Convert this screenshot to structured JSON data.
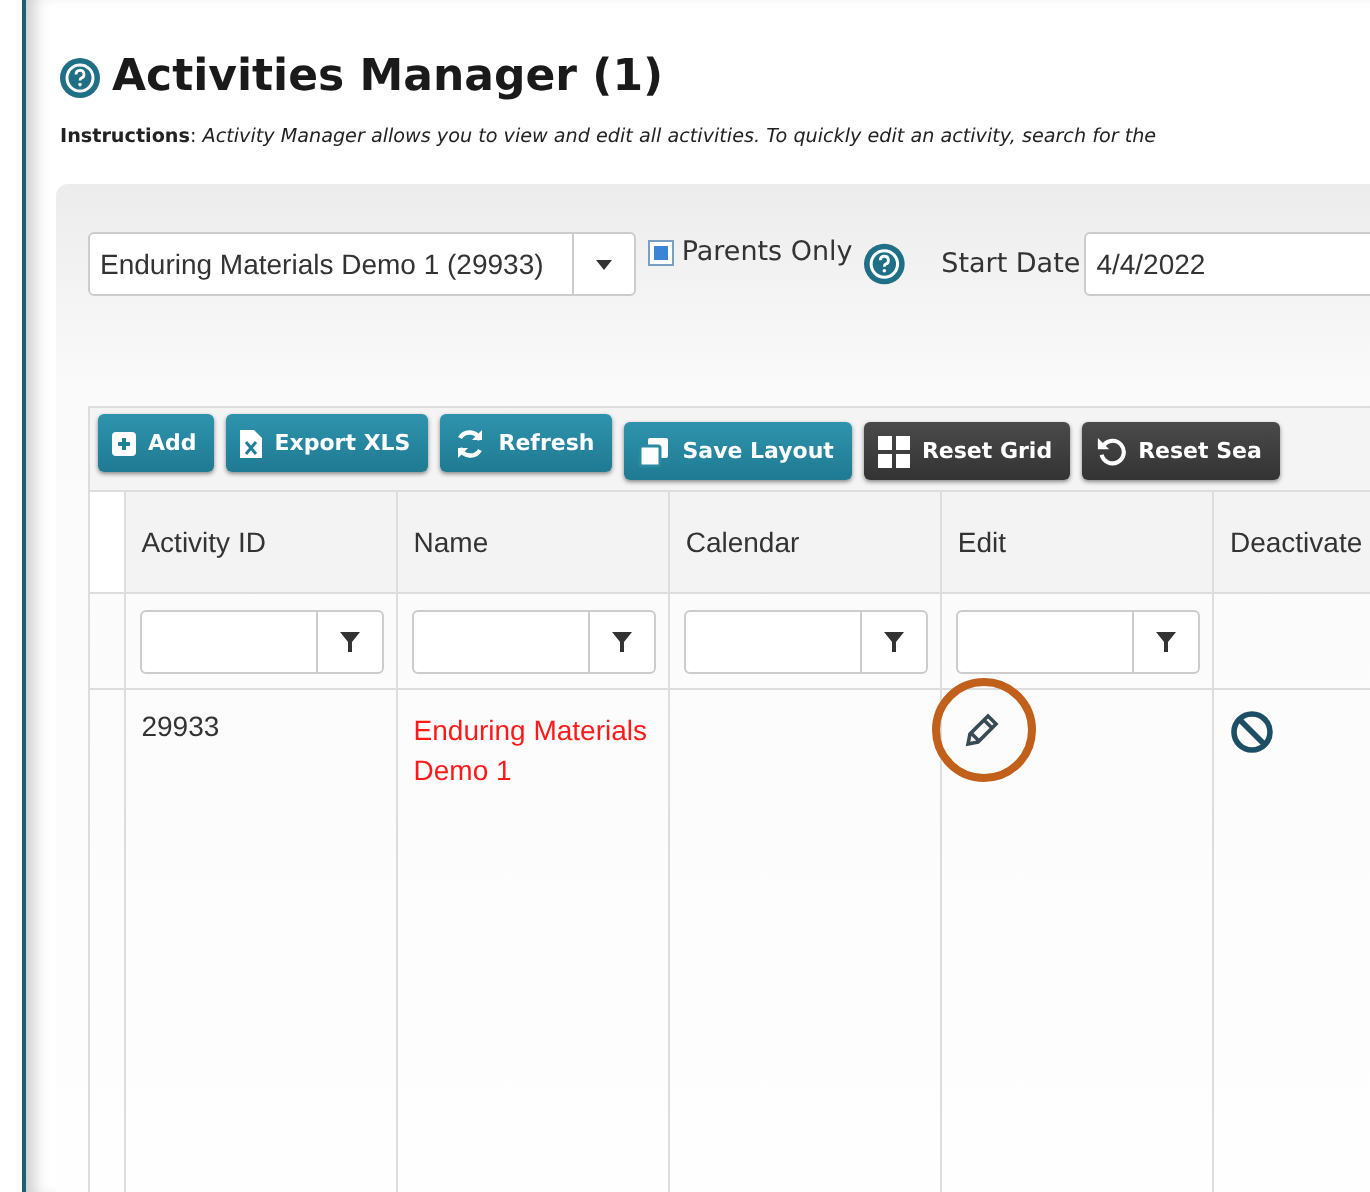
{
  "title": "Activities Manager (1)",
  "instructions": "**Instructions**: *Activity Manager allows you to view and edit all activities. To quickly edit an activity, search for the*",
  "filters": {
    "activity": "Enduring Materials Demo 1 (29933)",
    "parents_only": {
      "label": "Parents Only",
      "checked": true
    },
    "start_date": {
      "label": "Start Date",
      "value": "4/4/2022"
    }
  },
  "toolbar": [
    {
      "label": "Add",
      "kind": "add"
    },
    {
      "label": "Export XLS",
      "kind": "export"
    },
    {
      "label": "Refresh",
      "kind": "refresh"
    },
    {
      "label": "Save Layout",
      "kind": "save"
    },
    {
      "label": "Reset Grid",
      "kind": "grid"
    },
    {
      "label": "Reset Sea",
      "kind": "reset"
    }
  ],
  "table": {
    "columns": [
      {
        "label": "Activity ID",
        "filter": true
      },
      {
        "label": "Name",
        "filter": true
      },
      {
        "label": "Calendar",
        "filter": true
      },
      {
        "label": "Edit",
        "filter": true
      },
      {
        "label": "Deactivate",
        "filter": false
      }
    ],
    "rows": [
      {
        "activity_id": "29933",
        "name": "Enduring Materials Demo 1",
        "edit_highlighted": true
      }
    ]
  }
}
